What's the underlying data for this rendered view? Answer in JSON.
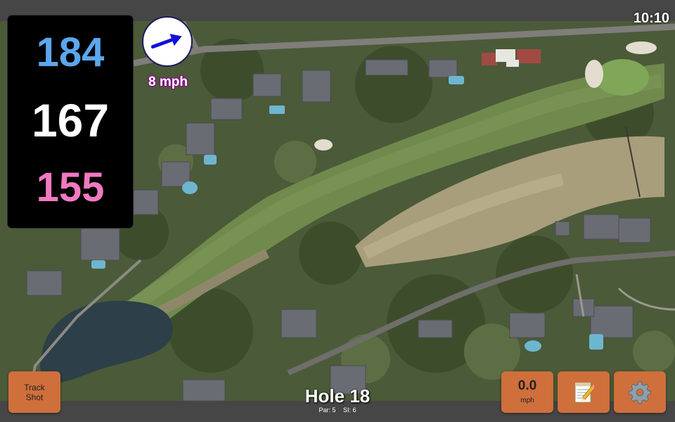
{
  "status": {
    "time": "10:10"
  },
  "distances": {
    "back": "184",
    "middle": "167",
    "front": "155"
  },
  "wind": {
    "speed_label": "8 mph",
    "direction_icon": "arrow-northeast-icon"
  },
  "hole": {
    "title": "Hole 18",
    "par_label": "Par: 5",
    "si_label": "SI: 6"
  },
  "buttons": {
    "track_shot_line1": "Track",
    "track_shot_line2": "Shot",
    "speed_value": "0.0",
    "speed_unit": "mph",
    "notes_icon": "notepad-icon",
    "settings_icon": "gear-icon"
  },
  "colors": {
    "back": "#5ba7ee",
    "middle": "#ffffff",
    "front": "#f179c1",
    "button": "#cf6f3c",
    "wind_arrow": "#1212d6"
  }
}
